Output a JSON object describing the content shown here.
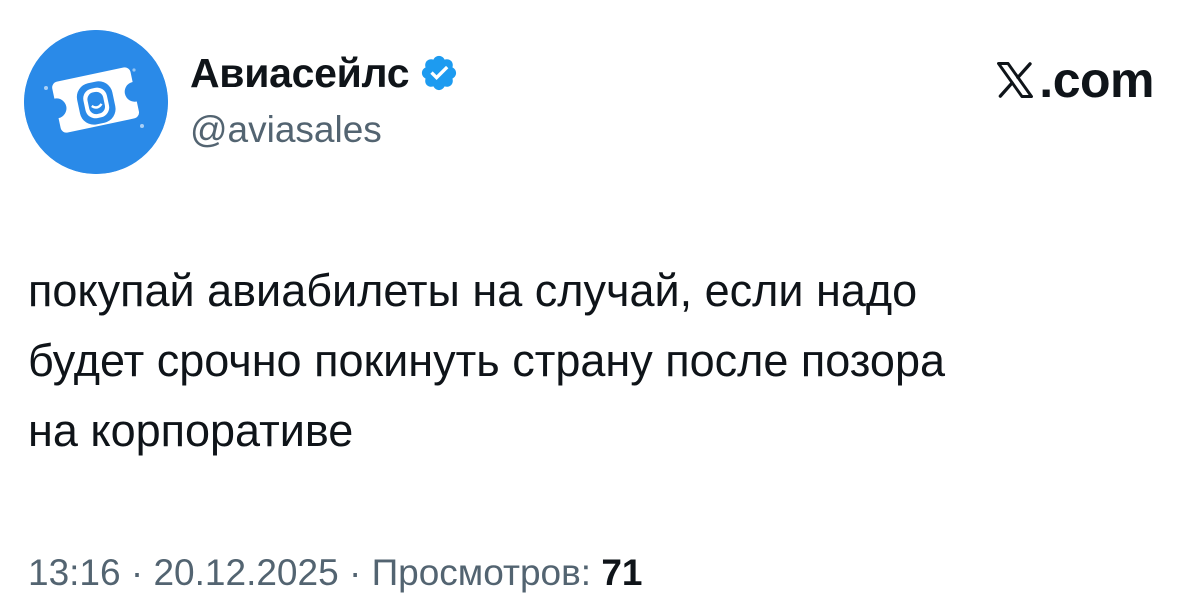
{
  "author": {
    "display_name": "Авиасейлс",
    "handle": "@aviasales",
    "verified": true,
    "avatar_icon": "ticket-window-icon",
    "avatar_color": "#2a8ae8"
  },
  "site": {
    "logo_icon": "x-logo-icon",
    "domain_text": ".com"
  },
  "tweet": {
    "lines": [
      "покупай авиабилеты на случай, если надо",
      "будет срочно покинуть страну после позора",
      "на корпоративе"
    ]
  },
  "meta": {
    "time": "13:16",
    "separator": " · ",
    "date": "20.12.2025",
    "views_label": "Просмотров:",
    "views_count": "71"
  },
  "colors": {
    "text": "#0f1419",
    "secondary": "#536471",
    "verified_blue": "#1d9bf0"
  }
}
